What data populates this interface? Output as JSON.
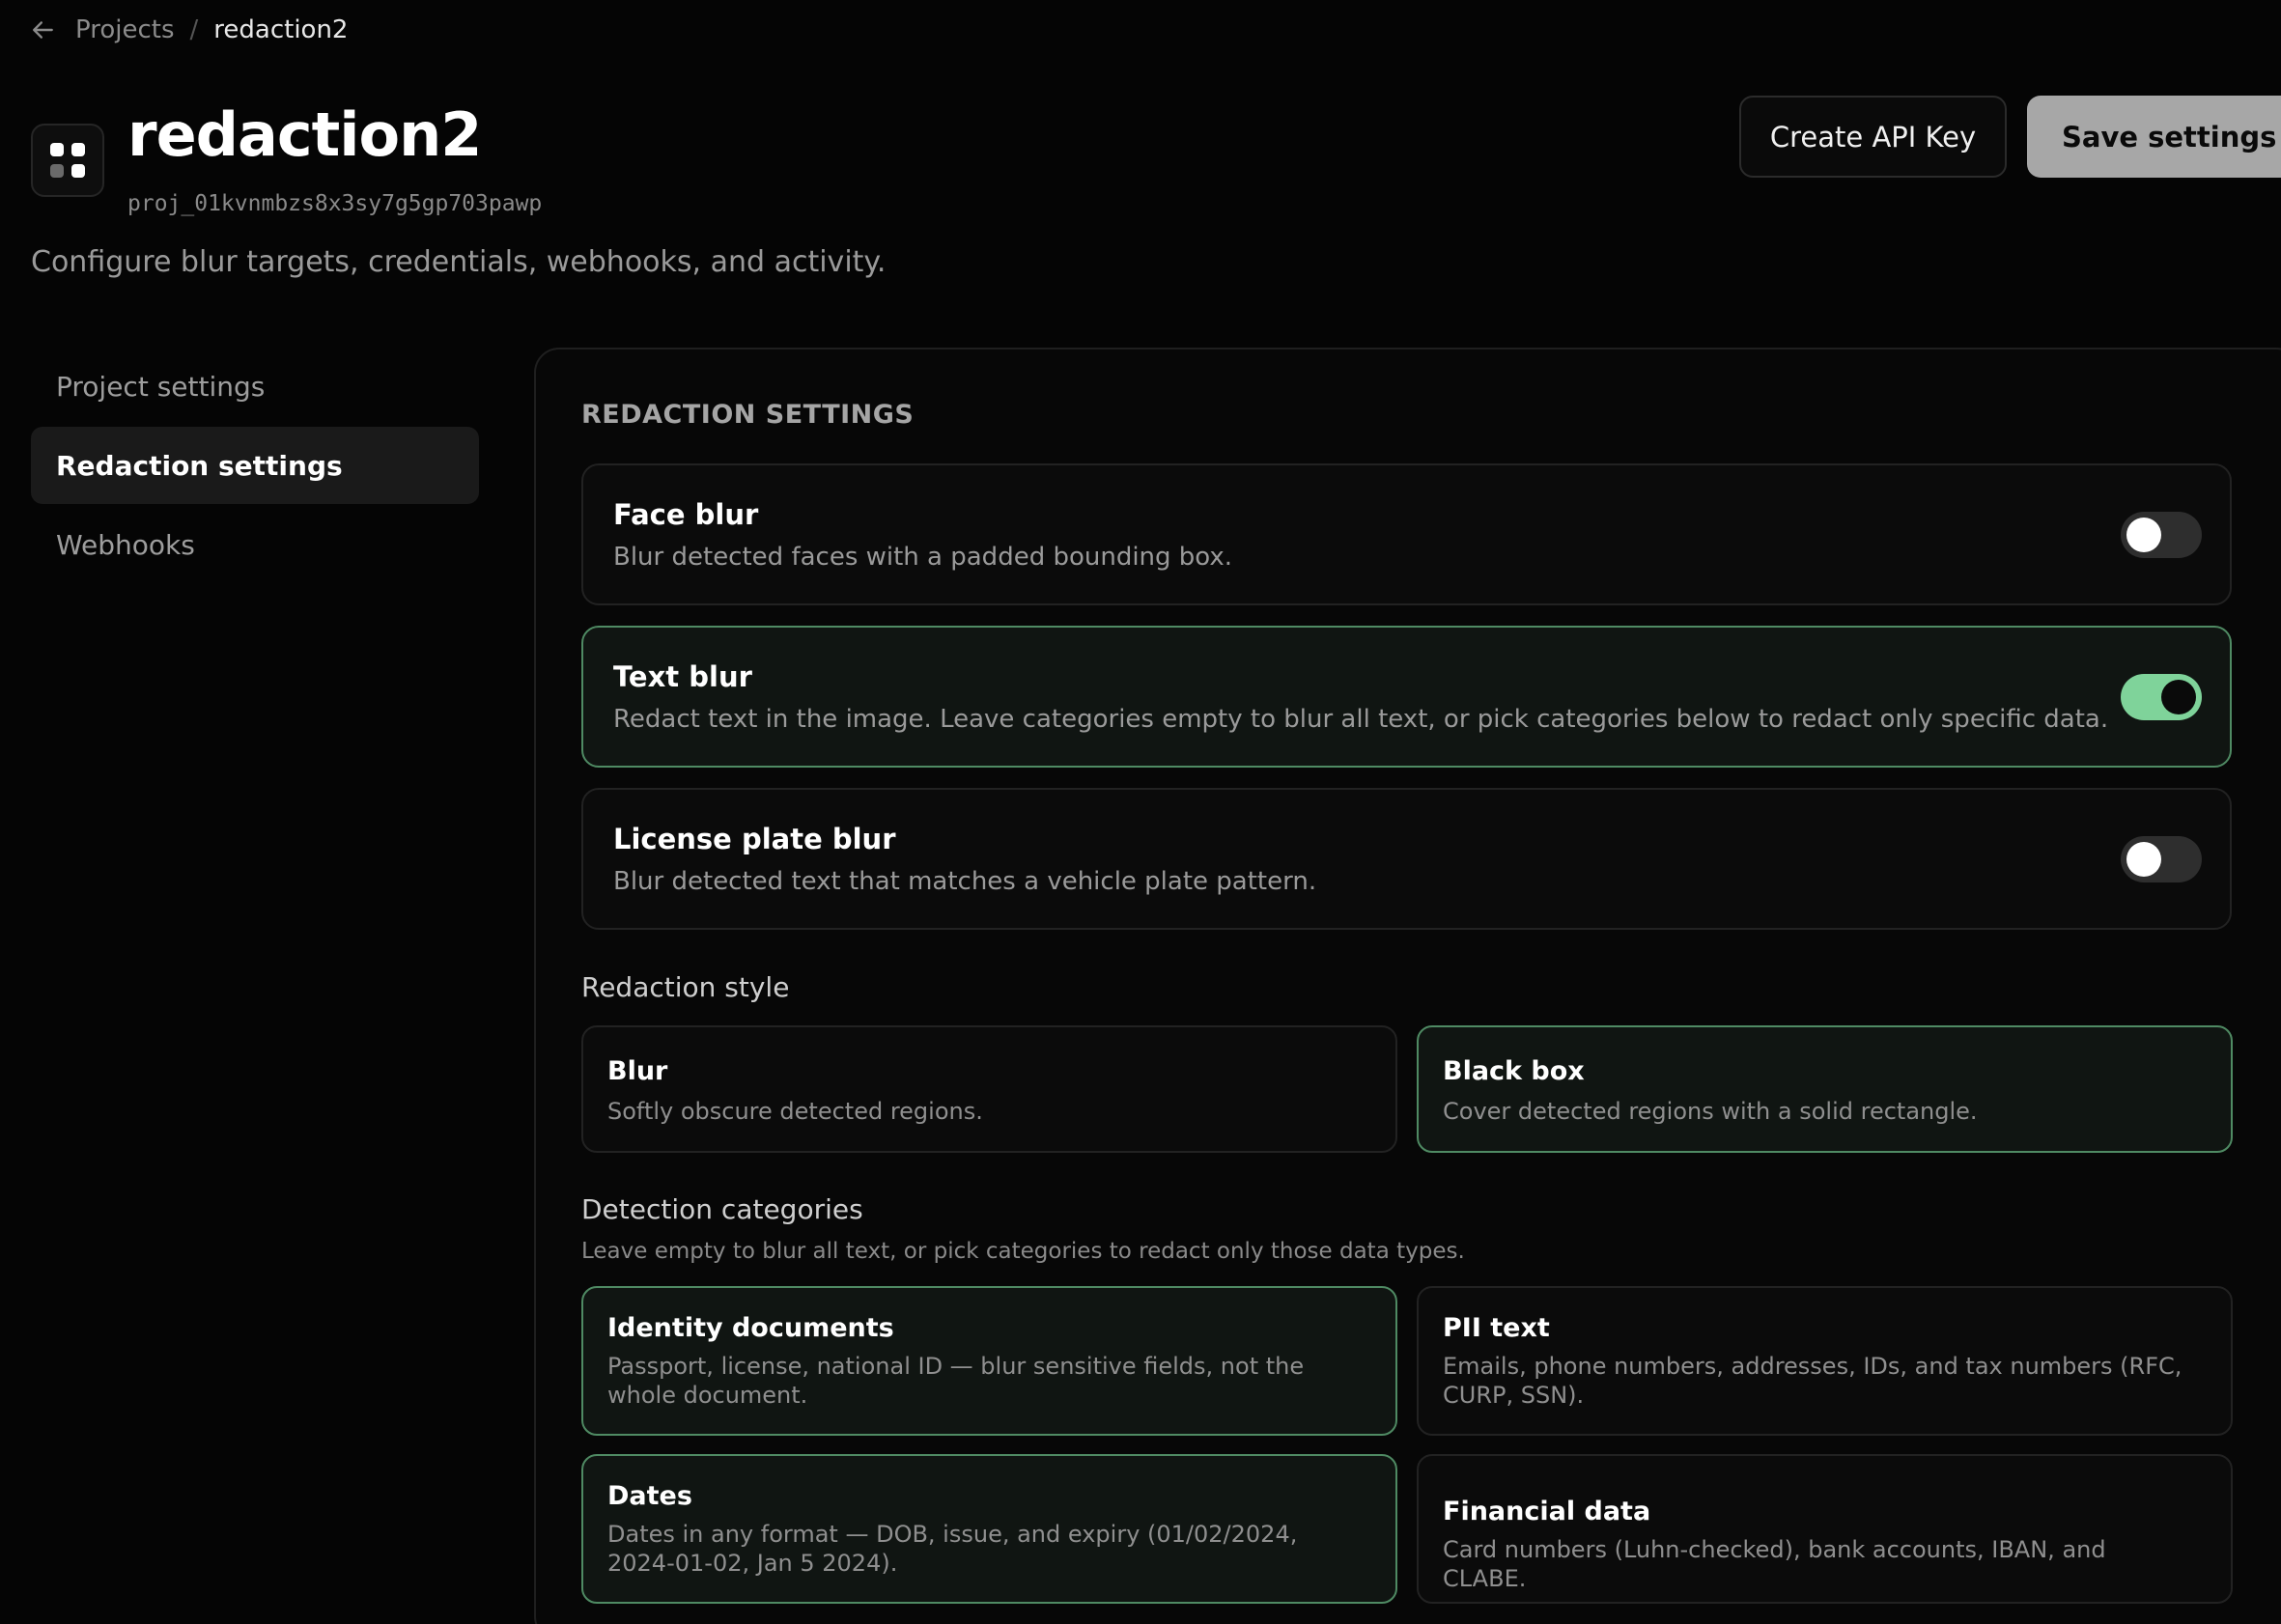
{
  "breadcrumb": {
    "back_icon": "arrow-left-icon",
    "parent": "Projects",
    "separator": "/",
    "current": "redaction2"
  },
  "header": {
    "title": "redaction2",
    "project_id": "proj_01kvnmbzs8x3sy7g5gp703pawp",
    "subtitle": "Configure blur targets, credentials, webhooks, and activity.",
    "create_api_key_label": "Create API Key",
    "save_label": "Save settings",
    "project_icon": "grid-icon"
  },
  "sidebar": {
    "items": [
      {
        "label": "Project settings",
        "active": false
      },
      {
        "label": "Redaction settings",
        "active": true
      },
      {
        "label": "Webhooks",
        "active": false
      }
    ]
  },
  "redaction": {
    "heading": "REDACTION SETTINGS",
    "toggles": [
      {
        "title": "Face blur",
        "description": "Blur detected faces with a padded bounding box.",
        "enabled": false
      },
      {
        "title": "Text blur",
        "description": "Redact text in the image. Leave categories empty to blur all text, or pick categories below to redact only specific data.",
        "enabled": true
      },
      {
        "title": "License plate blur",
        "description": "Blur detected text that matches a vehicle plate pattern.",
        "enabled": false
      }
    ],
    "style_label": "Redaction style",
    "styles": [
      {
        "title": "Blur",
        "description": "Softly obscure detected regions.",
        "selected": false
      },
      {
        "title": "Black box",
        "description": "Cover detected regions with a solid rectangle.",
        "selected": true
      }
    ],
    "categories_label": "Detection categories",
    "categories_hint": "Leave empty to blur all text, or pick categories to redact only those data types.",
    "categories": [
      {
        "title": "Identity documents",
        "description": "Passport, license, national ID — blur sensitive fields, not the whole document.",
        "selected": true
      },
      {
        "title": "PII text",
        "description": "Emails, phone numbers, addresses, IDs, and tax numbers (RFC, CURP, SSN).",
        "selected": false
      },
      {
        "title": "Dates",
        "description": "Dates in any format — DOB, issue, and expiry (01/02/2024, 2024-01-02, Jan 5 2024).",
        "selected": true
      },
      {
        "title": "Financial data",
        "description": "Card numbers (Luhn-checked), bank accounts, IBAN, and CLABE.",
        "selected": false
      }
    ]
  },
  "colors": {
    "accent_green": "#7fd39a",
    "selected_border": "#4f8a63",
    "background": "#050505"
  }
}
